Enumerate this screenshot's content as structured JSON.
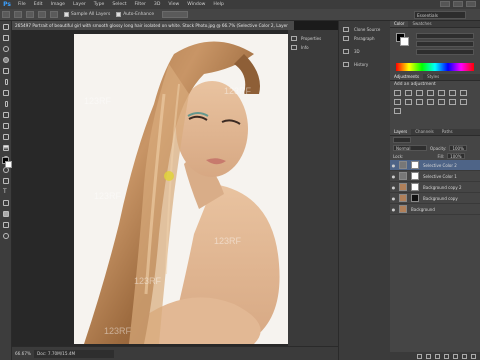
{
  "menu": [
    "File",
    "Edit",
    "Image",
    "Layer",
    "Type",
    "Select",
    "Filter",
    "3D",
    "View",
    "Window",
    "Help"
  ],
  "app_logo": "Ps",
  "options": {
    "sample_label": "Sample All Layers",
    "auto_enhance_label": "Auto-Enhance",
    "workspace": "Essentials"
  },
  "document_tab": "265497 Portrait of beautiful girl with smooth glossy long hair isolated on white. Stock Photo.jpg @ 66.7% (Selective Color 2, Layer",
  "mini_panels": [
    "Properties",
    "Info"
  ],
  "collapsed_panels": [
    {
      "label": "Clone Source",
      "icon": "clone-source-icon"
    },
    {
      "label": "Paragraph",
      "icon": "paragraph-icon"
    },
    {
      "label": "3D",
      "icon": "3d-icon"
    },
    {
      "label": "History",
      "icon": "history-icon"
    }
  ],
  "color_panel": {
    "tabs": [
      "Color",
      "Swatches"
    ],
    "active": 0
  },
  "adjustments_panel": {
    "tabs": [
      "Adjustments",
      "Styles"
    ],
    "heading": "Add an adjustment"
  },
  "layers_panel": {
    "tabs": [
      "Layers",
      "Channels",
      "Paths"
    ],
    "blend_mode": "Normal",
    "opacity_label": "Opacity:",
    "opacity": "100%",
    "lock_label": "Lock:",
    "fill_label": "Fill:",
    "fill": "100%",
    "layers": [
      {
        "name": "Selective Color 2",
        "selected": true
      },
      {
        "name": "Selective Color 1",
        "selected": false
      },
      {
        "name": "Background copy 2",
        "selected": false
      },
      {
        "name": "Background copy",
        "selected": false
      },
      {
        "name": "Background",
        "selected": false
      }
    ]
  },
  "status": {
    "zoom": "66.67%",
    "doc": "Doc: 7.70M/15.4M"
  },
  "watermarks": [
    "123RF",
    "123RF",
    "123RF",
    "123RF",
    "123RF",
    "123RF"
  ],
  "colors": {
    "accent": "#3aa0ff",
    "selected_layer": "#4e6487"
  }
}
